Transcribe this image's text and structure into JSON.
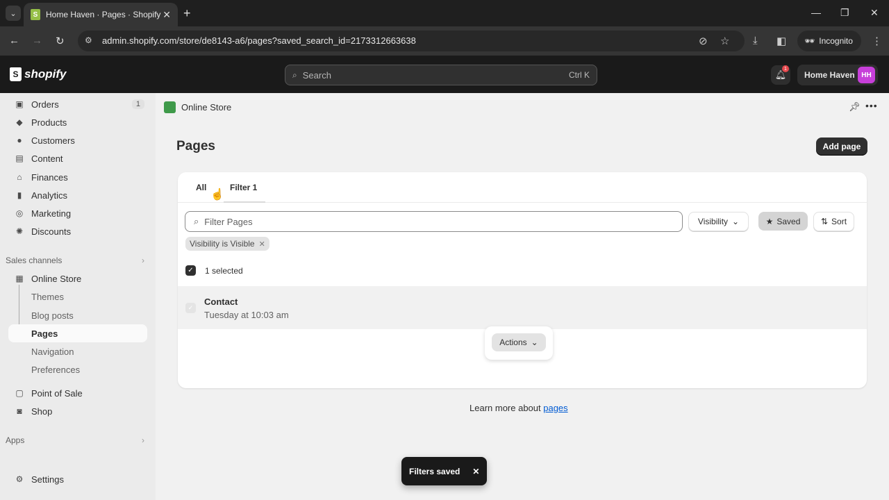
{
  "browser": {
    "tab_title": "Home Haven · Pages · Shopify",
    "url": "admin.shopify.com/store/de8143-a6/pages?saved_search_id=2173312663638",
    "incognito_label": "Incognito"
  },
  "topbar": {
    "logo_text": "shopify",
    "search_placeholder": "Search",
    "search_shortcut": "Ctrl K",
    "notification_count": "1",
    "store_name": "Home Haven",
    "avatar_initials": "HH",
    "avatar_color": "#c73fd9"
  },
  "sidebar": {
    "items": [
      {
        "label": "Orders",
        "icon": "inbox-icon",
        "count": "1"
      },
      {
        "label": "Products",
        "icon": "tag-icon"
      },
      {
        "label": "Customers",
        "icon": "person-icon"
      },
      {
        "label": "Content",
        "icon": "image-icon"
      },
      {
        "label": "Finances",
        "icon": "bank-icon"
      },
      {
        "label": "Analytics",
        "icon": "bar-chart-icon"
      },
      {
        "label": "Marketing",
        "icon": "target-icon"
      },
      {
        "label": "Discounts",
        "icon": "discount-icon"
      }
    ],
    "sales_channels_label": "Sales channels",
    "online_store_label": "Online Store",
    "sub_items": [
      "Themes",
      "Blog posts",
      "Pages",
      "Navigation",
      "Preferences"
    ],
    "active_sub_item": "Pages",
    "point_of_sale_label": "Point of Sale",
    "shop_label": "Shop",
    "apps_label": "Apps",
    "settings_label": "Settings"
  },
  "main": {
    "breadcrumb": "Online Store",
    "page_title": "Pages",
    "add_button": "Add page",
    "tabs": [
      {
        "label": "All",
        "active": false
      },
      {
        "label": "Filter 1",
        "active": true
      }
    ],
    "filter_placeholder": "Filter Pages",
    "visibility_label": "Visibility",
    "saved_label": "Saved",
    "sort_label": "Sort",
    "applied_filter": "Visibility is Visible",
    "selected_text": "1 selected",
    "rows": [
      {
        "title": "Contact",
        "date": "Tuesday at 10:03 am",
        "selected": true
      }
    ],
    "actions_label": "Actions",
    "learn_more_prefix": "Learn more about ",
    "learn_more_link": "pages"
  },
  "toast": {
    "message": "Filters saved"
  }
}
